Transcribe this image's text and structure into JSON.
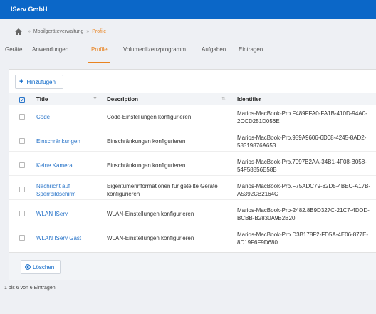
{
  "app": {
    "title": "IServ GmbH"
  },
  "breadcrumb": {
    "items": [
      "Mobilgeräteverwaltung",
      "Profile"
    ]
  },
  "tabs": [
    "Geräte",
    "Anwendungen",
    "Profile",
    "Volumenlizenzprogramm",
    "Aufgaben",
    "Eintragen"
  ],
  "active_tab": "Profile",
  "toolbar": {
    "add_label": "Hinzufügen"
  },
  "table": {
    "columns": {
      "title": "Title",
      "description": "Description",
      "identifier": "Identifier"
    },
    "rows": [
      {
        "title": [
          "Code",
          ""
        ],
        "description": [
          "Code-Einstellungen konfigurieren",
          ""
        ],
        "identifier": [
          "Marios-MacBook-Pro.F489FFA0-FA1B-410D-94A0-",
          "2CCD251D056E"
        ]
      },
      {
        "title": [
          "Einschränkungen",
          ""
        ],
        "description": [
          "Einschränkungen konfigurieren",
          ""
        ],
        "identifier": [
          "Marios-MacBook-Pro.959A9606-6D08-4245-8AD2-",
          "58319876A653"
        ]
      },
      {
        "title": [
          "Keine Kamera",
          ""
        ],
        "description": [
          "Einschränkungen konfigurieren",
          ""
        ],
        "identifier": [
          "Marios-MacBook-Pro.7097B2AA-34B1-4F08-B058-",
          "54F58856E58B"
        ]
      },
      {
        "title": [
          "Nachricht auf",
          "Sperrbildschirm"
        ],
        "description": [
          "Eigentümerinformationen für geteilte Geräte",
          "konfigurieren"
        ],
        "identifier": [
          "Marios-MacBook-Pro.F75ADC79-82D5-4BEC-A17B-",
          "A5392CB2164C"
        ]
      },
      {
        "title": [
          "WLAN IServ",
          ""
        ],
        "description": [
          "WLAN-Einstellungen konfigurieren",
          ""
        ],
        "identifier": [
          "Marios-MacBook-Pro-2482.8B9D327C-21C7-4DDD-",
          "BCBB-B2830A9B2B20"
        ]
      },
      {
        "title": [
          "WLAN IServ Gast",
          ""
        ],
        "description": [
          "WLAN-Einstellungen konfigurieren",
          ""
        ],
        "identifier": [
          "Marios-MacBook-Pro.D3B178F2-FD5A-4E06-877E-",
          "8D19F6F9D680"
        ]
      }
    ]
  },
  "footer": {
    "delete_label": "Löschen",
    "count_text": "1 bis 6 von 6 Einträgen"
  },
  "colors": {
    "brand": "#0b67c8",
    "accent": "#e98320",
    "link": "#2a75c9"
  },
  "icons": {
    "home": "home-icon",
    "add": "plus-icon",
    "delete": "remove-circle-icon",
    "select_all": "checkbox-checked-icon",
    "sort": "sort-icon"
  }
}
